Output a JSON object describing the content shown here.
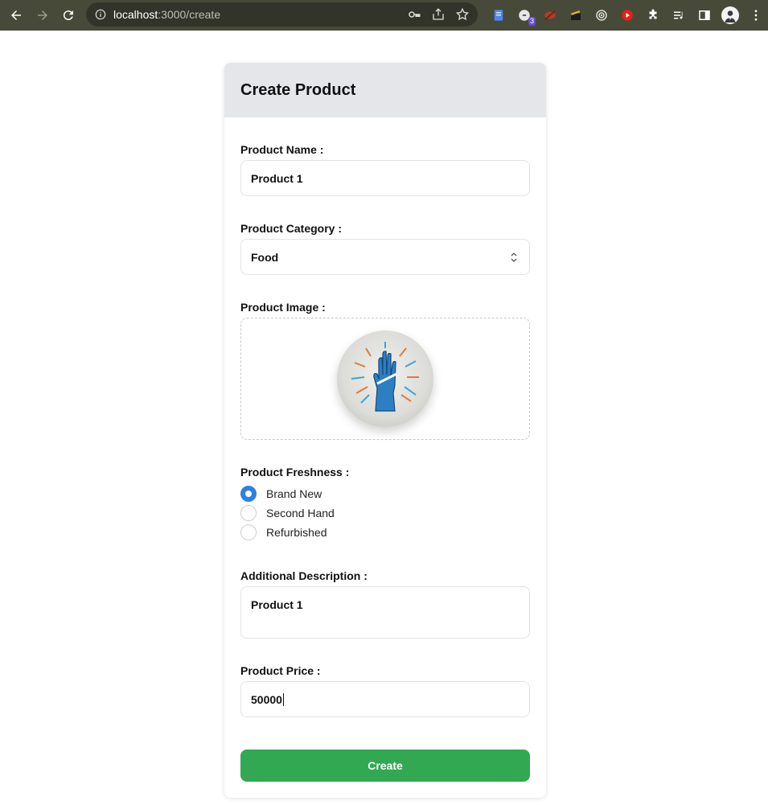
{
  "browser": {
    "url_host": "localhost",
    "url_rest": ":3000/create",
    "extension_badge": "3"
  },
  "form": {
    "title": "Create Product",
    "name_label": "Product Name :",
    "name_value": "Product 1",
    "category_label": "Product Category :",
    "category_value": "Food",
    "image_label": "Product Image :",
    "freshness_label": "Product Freshness :",
    "freshness_options": [
      "Brand New",
      "Second Hand",
      "Refurbished"
    ],
    "freshness_selected": "Brand New",
    "description_label": "Additional Description :",
    "description_value": "Product 1",
    "price_label": "Product Price :",
    "price_value": "50000",
    "submit_label": "Create"
  },
  "colors": {
    "primary": "#2f80e0",
    "submit": "#32a852",
    "header_bg": "#e5e6ea",
    "toolbar_bg": "#474a38"
  }
}
